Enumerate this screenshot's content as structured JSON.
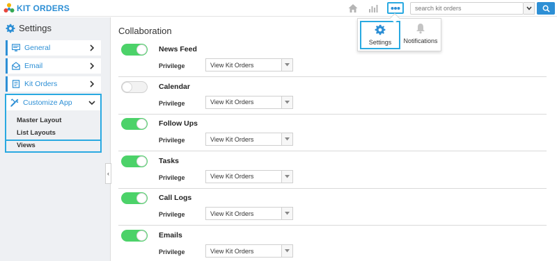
{
  "app": {
    "title": "KIT ORDERS"
  },
  "header": {
    "home_icon": "home-icon",
    "reports_icon": "bar-chart-icon",
    "more_icon": "more-dots-icon",
    "search": {
      "placeholder": "search kit orders",
      "value": ""
    },
    "search_button_icon": "search-icon"
  },
  "menu_popup": {
    "items": [
      {
        "label": "Settings",
        "icon": "gear-icon",
        "selected": true
      },
      {
        "label": "Notifications",
        "icon": "bell-icon",
        "selected": false
      }
    ]
  },
  "sidebar": {
    "title": "Settings",
    "items": [
      {
        "label": "General",
        "icon": "monitor-icon"
      },
      {
        "label": "Email",
        "icon": "email-icon"
      },
      {
        "label": "Kit Orders",
        "icon": "document-icon"
      },
      {
        "label": "Customize App",
        "icon": "tools-icon",
        "expanded": true
      }
    ],
    "sub_items": [
      "Master Layout",
      "List Layouts",
      "Views"
    ],
    "collapse_glyph": "‹"
  },
  "main": {
    "title": "Collaboration",
    "rows": [
      {
        "name": "News Feed",
        "enabled": true,
        "privilege_label": "Privilege",
        "privilege_value": "View Kit Orders"
      },
      {
        "name": "Calendar",
        "enabled": false,
        "privilege_label": "Privilege",
        "privilege_value": "View Kit Orders"
      },
      {
        "name": "Follow Ups",
        "enabled": true,
        "privilege_label": "Privilege",
        "privilege_value": "View Kit Orders"
      },
      {
        "name": "Tasks",
        "enabled": true,
        "privilege_label": "Privilege",
        "privilege_value": "View Kit Orders"
      },
      {
        "name": "Call Logs",
        "enabled": true,
        "privilege_label": "Privilege",
        "privilege_value": "View Kit Orders"
      },
      {
        "name": "Emails",
        "enabled": true,
        "privilege_label": "Privilege",
        "privilege_value": "View Kit Orders"
      }
    ]
  },
  "colors": {
    "accent": "#2d8fd5",
    "highlight": "#29a9e1",
    "toggle_on": "#4cd269",
    "sidebar_bg": "#eef0f3"
  }
}
